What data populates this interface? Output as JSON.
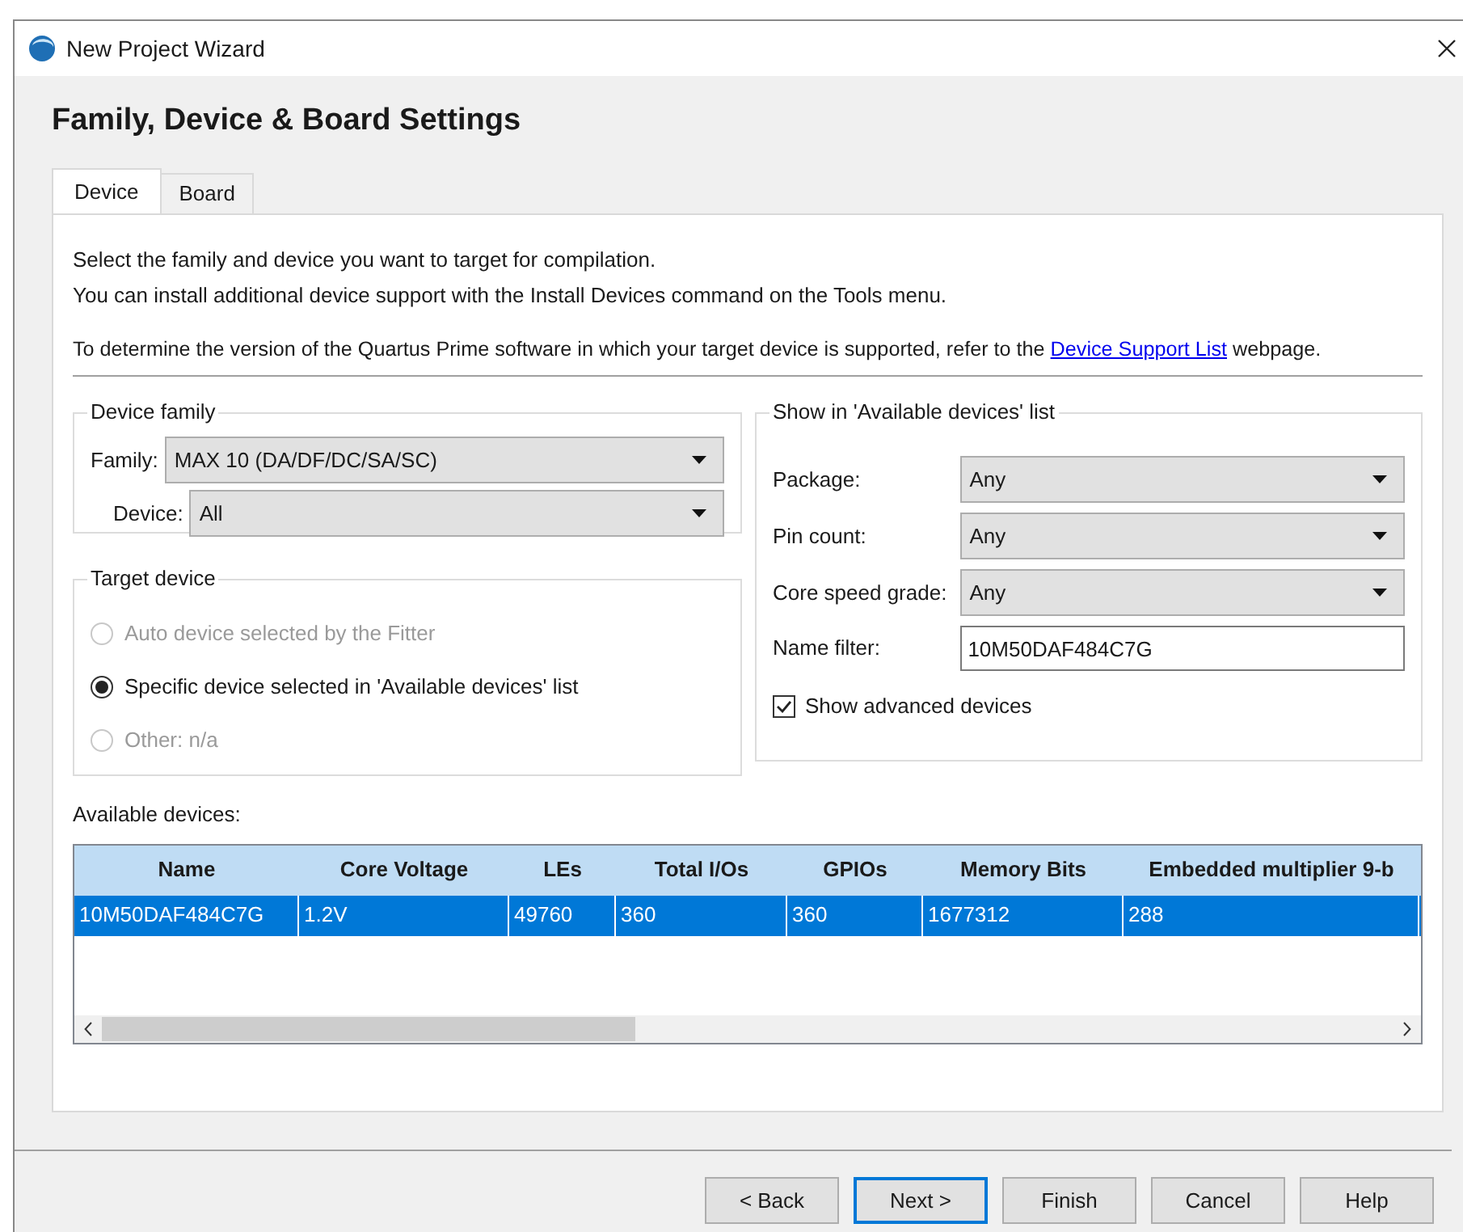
{
  "window": {
    "title": "New Project Wizard"
  },
  "heading": "Family, Device & Board Settings",
  "tabs": [
    {
      "label": "Device",
      "selected": true
    },
    {
      "label": "Board",
      "selected": false
    }
  ],
  "intro": [
    "Select the family and device you want to target for compilation.",
    "You can install additional device support with the Install Devices command on the Tools menu."
  ],
  "support_note": {
    "before": "To determine the version of the Quartus Prime software in which your target device is supported, refer to the",
    "link": "Device Support List",
    "after": "webpage."
  },
  "device_family": {
    "title": "Device family",
    "fields": [
      {
        "label": "Family:",
        "value": "MAX 10 (DA/DF/DC/SA/SC)"
      },
      {
        "label": "Device:",
        "value": "All"
      }
    ]
  },
  "target_device": {
    "title": "Target device",
    "options": [
      {
        "label": "Auto device selected by the Fitter",
        "selected": false,
        "disabled": true
      },
      {
        "label": "Specific device selected in 'Available devices' list",
        "selected": true,
        "disabled": false
      },
      {
        "label": "Other:  n/a",
        "selected": false,
        "disabled": true
      }
    ]
  },
  "show_in_list": {
    "title": "Show in 'Available devices' list",
    "fields": [
      {
        "kind": "dropdown",
        "label": "Package:",
        "value": "Any"
      },
      {
        "kind": "dropdown",
        "label": "Pin count:",
        "value": "Any"
      },
      {
        "kind": "dropdown",
        "label": "Core speed grade:",
        "value": "Any"
      },
      {
        "kind": "text",
        "label": "Name filter:",
        "value": "10M50DAF484C7G"
      }
    ],
    "advanced": {
      "label": "Show advanced devices",
      "checked": true
    }
  },
  "available_devices": {
    "label": "Available devices:",
    "columns": [
      "Name",
      "Core Voltage",
      "LEs",
      "Total I/Os",
      "GPIOs",
      "Memory Bits",
      "Embedded multiplier 9-b"
    ],
    "rows": [
      {
        "cells": [
          "10M50DAF484C7G",
          "1.2V",
          "49760",
          "360",
          "360",
          "1677312",
          "288"
        ],
        "selected": true
      }
    ]
  },
  "buttons": [
    {
      "label": "< Back",
      "default": false
    },
    {
      "label": "Next >",
      "default": true
    },
    {
      "label": "Finish",
      "default": false
    },
    {
      "label": "Cancel",
      "default": false
    },
    {
      "label": "Help",
      "default": false
    }
  ]
}
